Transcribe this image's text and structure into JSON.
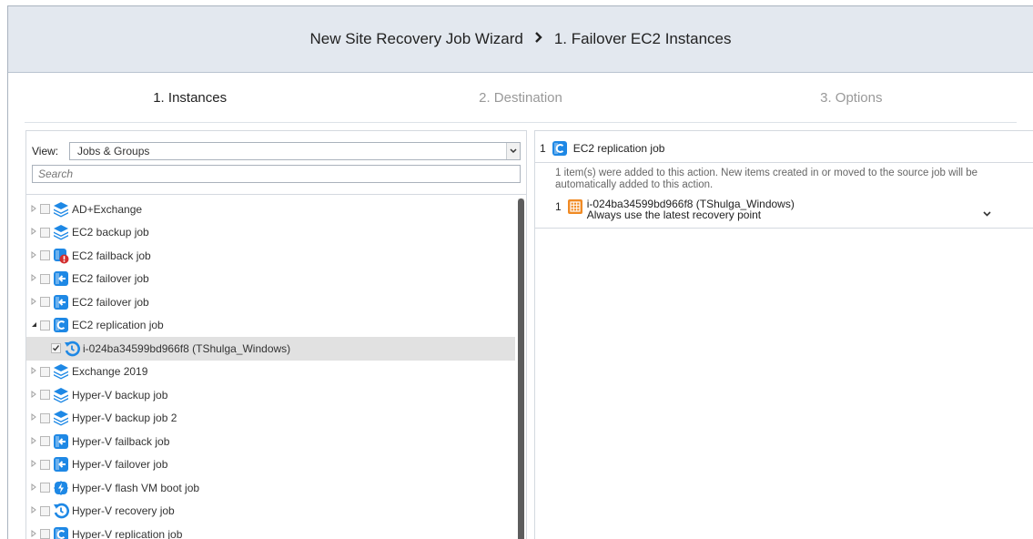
{
  "header": {
    "wizard_title": "New Site Recovery Job Wizard",
    "separator": "›",
    "step_title": "1. Failover EC2 Instances"
  },
  "steps": [
    {
      "label": "1. Instances",
      "active": true
    },
    {
      "label": "2. Destination",
      "active": false
    },
    {
      "label": "3. Options",
      "active": false
    }
  ],
  "left": {
    "view_label": "View:",
    "view_value": "Jobs & Groups",
    "search_placeholder": "Search",
    "tree": [
      {
        "label": "AD+Exchange",
        "icon": "backup-job-icon"
      },
      {
        "label": "EC2 backup job",
        "icon": "backup-job-icon"
      },
      {
        "label": "EC2 failback job",
        "icon": "failback-job-error-icon"
      },
      {
        "label": "EC2 failover job",
        "icon": "failover-job-icon"
      },
      {
        "label": "EC2 failover job",
        "icon": "failover-job-icon"
      },
      {
        "label": "EC2 replication job",
        "icon": "replication-job-icon",
        "expanded": true
      },
      {
        "label": "i-024ba34599bd966f8 (TShulga_Windows)",
        "icon": "recovery-point-icon",
        "child": true,
        "checked": true
      },
      {
        "label": "Exchange 2019",
        "icon": "backup-job-icon"
      },
      {
        "label": "Hyper-V backup job",
        "icon": "backup-job-icon"
      },
      {
        "label": "Hyper-V backup job 2",
        "icon": "backup-job-icon"
      },
      {
        "label": "Hyper-V failback job",
        "icon": "failover-job-icon"
      },
      {
        "label": "Hyper-V failover job",
        "icon": "failover-job-icon"
      },
      {
        "label": "Hyper-V flash VM boot job",
        "icon": "flash-boot-icon"
      },
      {
        "label": "Hyper-V recovery job",
        "icon": "recovery-job-icon"
      },
      {
        "label": "Hyper-V replication job",
        "icon": "replication-job-icon"
      }
    ]
  },
  "right": {
    "job_number": "1",
    "job_name": "EC2 replication job",
    "info_text": "1 item(s) were added to this action. New items created in or moved to the source job will be automatically added to this action.",
    "item_number": "1",
    "item_name": "i-024ba34599bd966f8 (TShulga_Windows)",
    "item_recovery": "Always use the latest recovery point"
  },
  "colors": {
    "accent_blue": "#1e88e5",
    "header_bg": "#e3e8ef",
    "error_red": "#d32f2f",
    "instance_orange": "#f08a24"
  }
}
